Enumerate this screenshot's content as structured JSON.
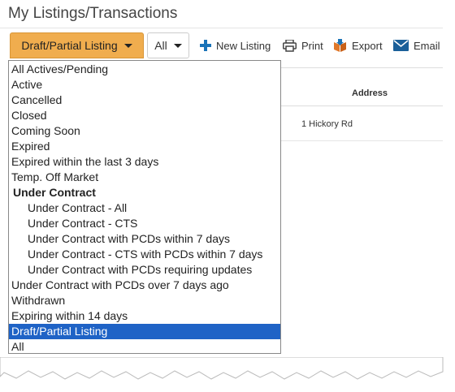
{
  "page": {
    "title": "My Listings/Transactions"
  },
  "toolbar": {
    "status_dropdown_label": "Draft/Partial Listing",
    "all_dropdown_label": "All",
    "new_listing_label": "New Listing",
    "print_label": "Print",
    "export_label": "Export",
    "email_label": "Email"
  },
  "table": {
    "address_header": "Address",
    "rows": [
      {
        "address": "1 Hickory Rd"
      }
    ]
  },
  "dropdown": {
    "options": [
      {
        "label": "All Actives/Pending",
        "kind": "option"
      },
      {
        "label": "Active",
        "kind": "option"
      },
      {
        "label": "Cancelled",
        "kind": "option"
      },
      {
        "label": "Closed",
        "kind": "option"
      },
      {
        "label": "Coming Soon",
        "kind": "option"
      },
      {
        "label": "Expired",
        "kind": "option"
      },
      {
        "label": "Expired within the last 3 days",
        "kind": "option"
      },
      {
        "label": "Temp. Off Market",
        "kind": "option"
      },
      {
        "label": "Under Contract",
        "kind": "group"
      },
      {
        "label": "Under Contract - All",
        "kind": "sub"
      },
      {
        "label": "Under Contract - CTS",
        "kind": "sub"
      },
      {
        "label": "Under Contract with PCDs within 7 days",
        "kind": "sub"
      },
      {
        "label": "Under Contract - CTS with PCDs within 7 days",
        "kind": "sub"
      },
      {
        "label": "Under Contract with PCDs requiring updates",
        "kind": "sub"
      },
      {
        "label": "Under Contract with PCDs over 7 days ago",
        "kind": "option"
      },
      {
        "label": "Withdrawn",
        "kind": "option"
      },
      {
        "label": "Expiring within 14 days",
        "kind": "option"
      },
      {
        "label": "Draft/Partial Listing",
        "kind": "option"
      },
      {
        "label": "All",
        "kind": "option"
      }
    ],
    "selected": "Draft/Partial Listing",
    "selected_color": "#1f63c6"
  },
  "colors": {
    "status_button": "#f0ad4e",
    "icon_blue": "#1a73b8",
    "export_orange": "#e0782a"
  }
}
